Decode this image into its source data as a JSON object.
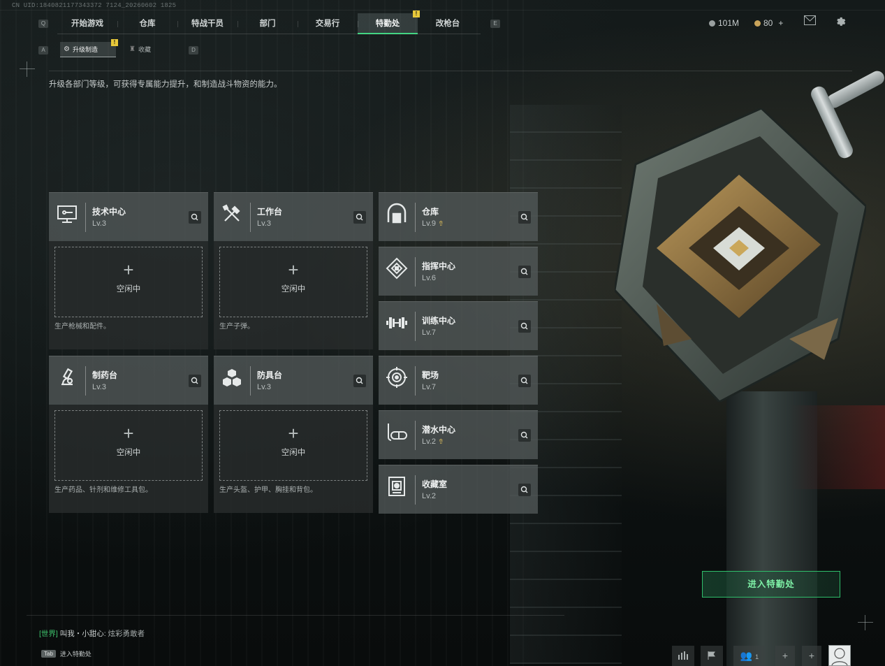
{
  "uid": "CN UID:1840821177343372 7124_20260602 1825",
  "nav": {
    "left_key": "Q",
    "right_key": "E",
    "tabs": [
      {
        "label": "开始游戏"
      },
      {
        "label": "仓库"
      },
      {
        "label": "特战干员"
      },
      {
        "label": "部门"
      },
      {
        "label": "交易行"
      },
      {
        "label": "特勤处",
        "active": true,
        "badge": "!"
      },
      {
        "label": "改枪台"
      }
    ]
  },
  "currency": {
    "hafcoin": "101M",
    "premium": "80",
    "premium_add": "+"
  },
  "subnav": {
    "left_key": "A",
    "right_key": "D",
    "tabs": [
      {
        "label": "升级制造",
        "active": true,
        "badge": "!"
      },
      {
        "label": "收藏"
      }
    ]
  },
  "description": "升级各部门等级，可获得专属能力提升，和制造战斗物资的能力。",
  "production_slots": [
    {
      "name": "技术中心",
      "level": "Lv.3",
      "icon": "tech-center-icon",
      "status": "空闲中",
      "produces": "生产枪械和配件。"
    },
    {
      "name": "工作台",
      "level": "Lv.3",
      "icon": "workbench-icon",
      "status": "空闲中",
      "produces": "生产子弹。"
    },
    {
      "name": "制药台",
      "level": "Lv.3",
      "icon": "pharmacy-icon",
      "status": "空闲中",
      "produces": "生产药品、针剂和维修工具包。"
    },
    {
      "name": "防具台",
      "level": "Lv.3",
      "icon": "armor-bench-icon",
      "status": "空闲中",
      "produces": "生产头盔、护甲、胸挂和背包。"
    }
  ],
  "facilities": [
    {
      "name": "仓库",
      "level": "Lv.9",
      "icon": "warehouse-icon",
      "upgradable": true
    },
    {
      "name": "指挥中心",
      "level": "Lv.6",
      "icon": "command-center-icon",
      "upgradable": false
    },
    {
      "name": "训练中心",
      "level": "Lv.7",
      "icon": "training-center-icon",
      "upgradable": false
    },
    {
      "name": "靶场",
      "level": "Lv.7",
      "icon": "shooting-range-icon",
      "upgradable": false
    },
    {
      "name": "潜水中心",
      "level": "Lv.2",
      "icon": "diving-center-icon",
      "upgradable": true
    },
    {
      "name": "收藏室",
      "level": "Lv.2",
      "icon": "collection-room-icon",
      "upgradable": false
    }
  ],
  "enter_button": "进入特勤处",
  "chat": {
    "channel": "[世界]",
    "sender": "叫我・小甜心:",
    "message": "炫彩勇敢者"
  },
  "tab_hint": {
    "key": "Tab",
    "label": "进入特勤处"
  },
  "friends_count": "1",
  "colors": {
    "accent_green": "#35d27a",
    "badge_yellow": "#e8c93a",
    "upgrade_gold": "#d7b85a"
  }
}
